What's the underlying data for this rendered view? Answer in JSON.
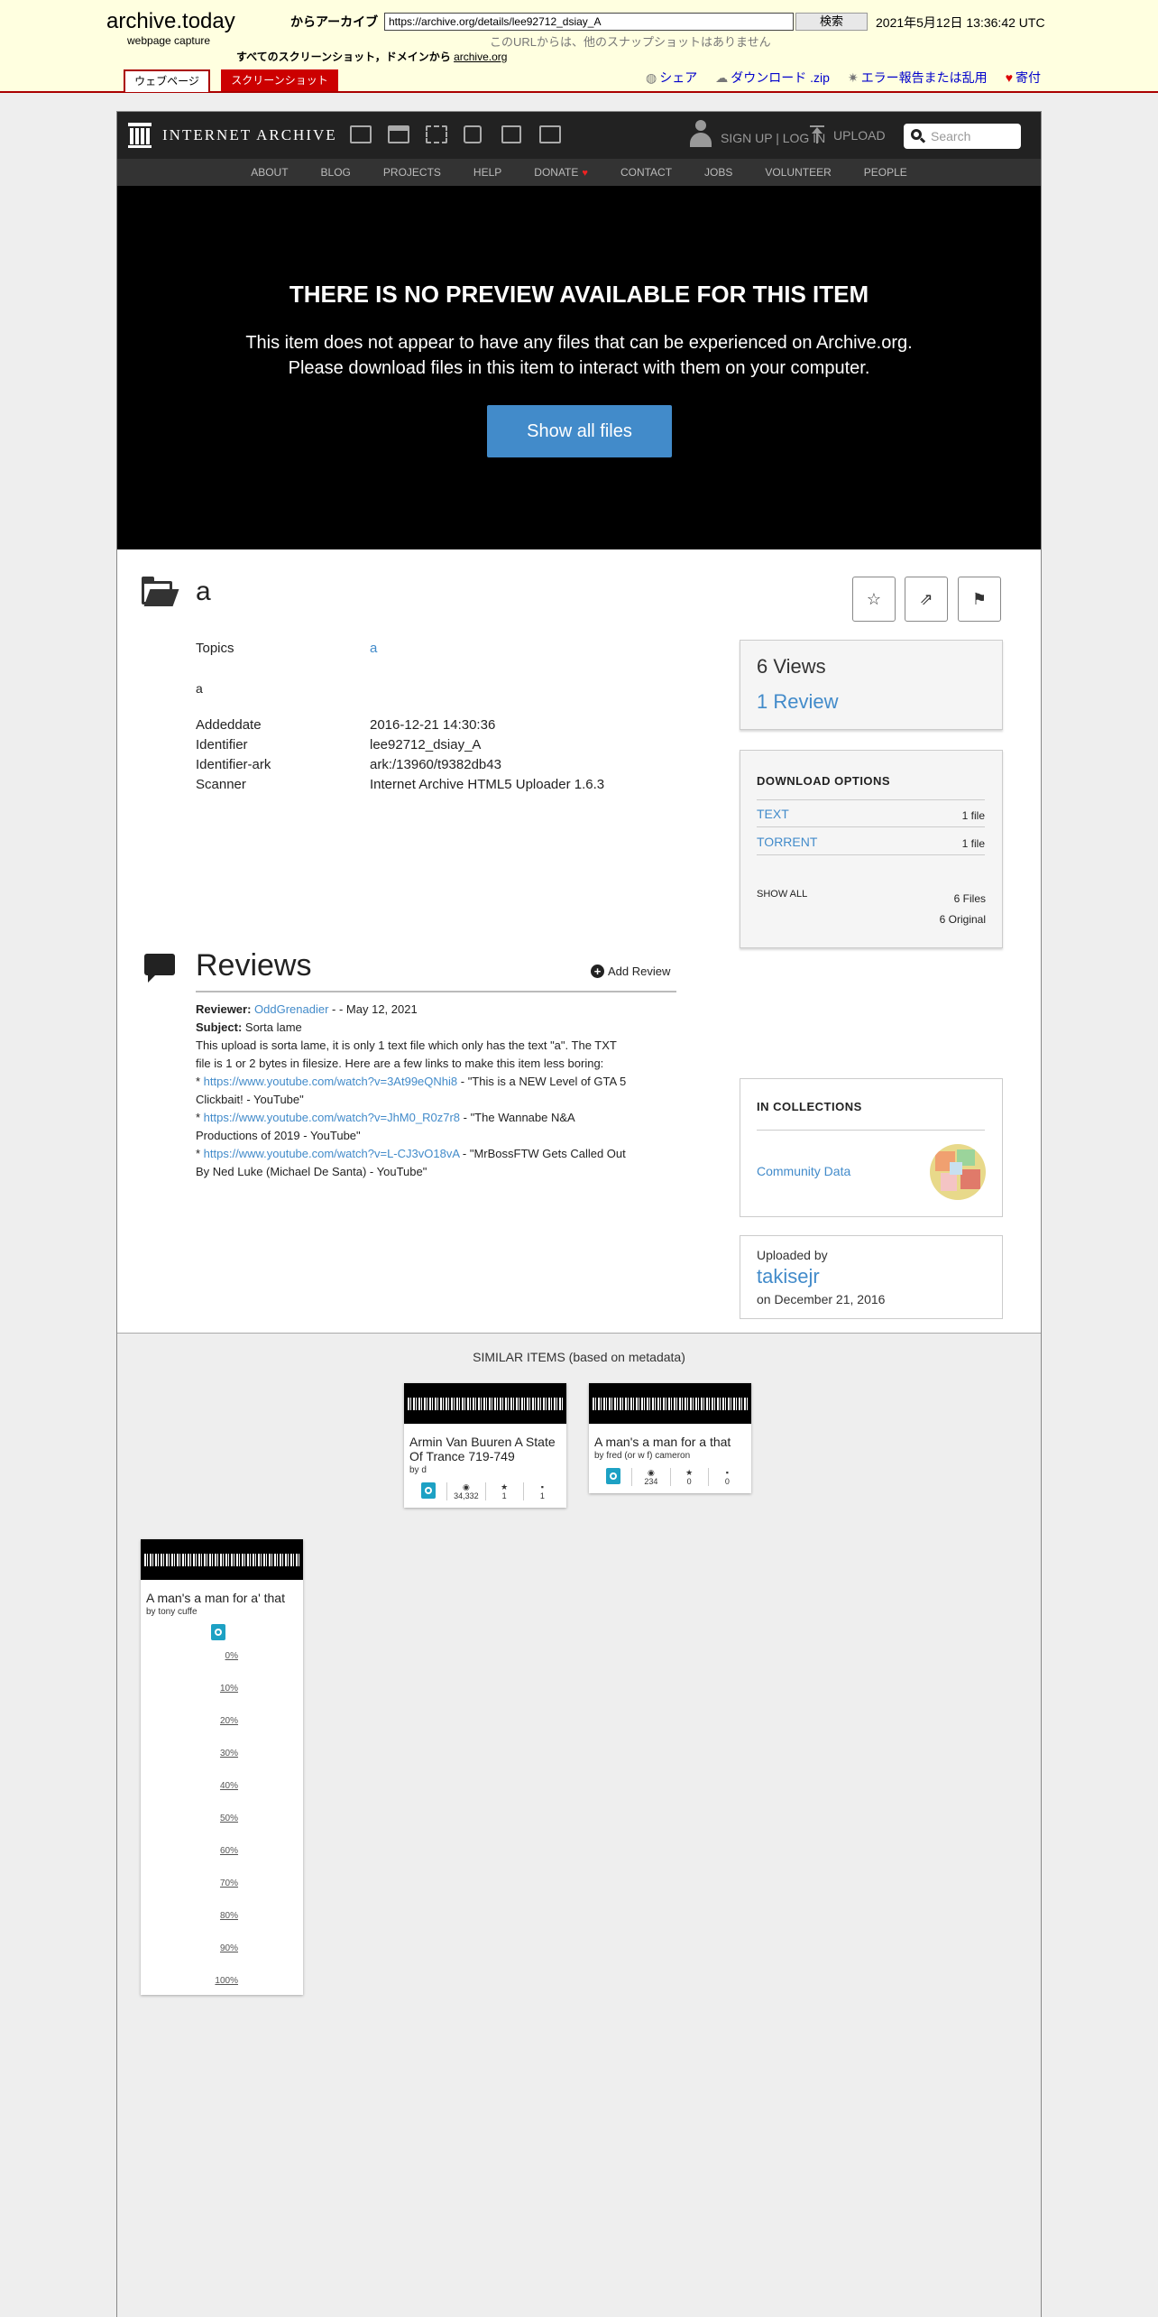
{
  "archive_today": {
    "logo": "archive.today",
    "subtitle": "webpage capture",
    "from_label": "からアーカイブ",
    "url_value": "https://archive.org/details/lee92712_dsiay_A",
    "search_button": "検索",
    "capture_date": "2021年5月12日 13:36:42 UTC",
    "no_snapshots": "このURLからは、他のスナップショットはありません",
    "all_snapshots_prefix": "すべてのスクリーンショット，ドメインから",
    "all_snapshots_domain": "archive.org",
    "tab_webpage": "ウェブページ",
    "tab_screenshot": "スクリーンショット",
    "action_share": "シェア",
    "action_download": "ダウンロード .zip",
    "action_report": "エラー報告または乱用",
    "action_donate": "寄付"
  },
  "ia_nav": {
    "logo_text": "INTERNET ARCHIVE",
    "signup": "SIGN UP | LOG IN",
    "upload": "UPLOAD",
    "search_placeholder": "Search",
    "subnav": [
      "ABOUT",
      "BLOG",
      "PROJECTS",
      "HELP",
      "DONATE",
      "CONTACT",
      "JOBS",
      "VOLUNTEER",
      "PEOPLE"
    ]
  },
  "preview": {
    "heading": "THERE IS NO PREVIEW AVAILABLE FOR THIS ITEM",
    "line1": "This item does not appear to have any files that can be experienced on Archive.org.",
    "line2": "Please download files in this item to interact with them on your computer.",
    "button": "Show all files"
  },
  "item": {
    "title": "a",
    "topics_label": "Topics",
    "topics_value": "a",
    "description": "a",
    "addeddate_label": "Addeddate",
    "addeddate_value": "2016-12-21 14:30:36",
    "identifier_label": "Identifier",
    "identifier_value": "lee92712_dsiay_A",
    "identifier_ark_label": "Identifier-ark",
    "identifier_ark_value": "ark:/13960/t9382db43",
    "scanner_label": "Scanner",
    "scanner_value": "Internet Archive HTML5 Uploader 1.6.3"
  },
  "reviews": {
    "heading": "Reviews",
    "add_review": "Add Review",
    "reviewer_label": "Reviewer:",
    "reviewer_name": "OddGrenadier",
    "reviewer_date": " - - May 12, 2021",
    "subject_label": "Subject:",
    "subject_value": " Sorta lame",
    "body1": "This upload is sorta lame, it is only 1 text file which only has the text \"a\". The TXT",
    "body2": "file is 1 or 2 bytes in filesize. Here are a few links to make this item less boring:",
    "link1": "https://www.youtube.com/watch?v=3At99eQNhi8",
    "link1_desc": " - \"This is a NEW Level of GTA 5",
    "link1_desc2": "Clickbait! - YouTube\"",
    "link2": "https://www.youtube.com/watch?v=JhM0_R0z7r8",
    "link2_desc": " - \"The Wannabe N&A",
    "link2_desc2": "Productions of 2019 - YouTube\"",
    "link3": "https://www.youtube.com/watch?v=L-CJ3vO18vA",
    "link3_desc": " - \"MrBossFTW Gets Called Out",
    "link3_desc2": "By Ned Luke (Michael De Santa) - YouTube\""
  },
  "sidebar": {
    "views": "6 Views",
    "reviews_link": "1 Review",
    "download_heading": "DOWNLOAD OPTIONS",
    "downloads": [
      {
        "label": "TEXT",
        "count": "1 file"
      },
      {
        "label": "TORRENT",
        "count": "1 file"
      }
    ],
    "show_all": "SHOW ALL",
    "files_count": "6 Files",
    "original_count": "6 Original",
    "collections_heading": "IN COLLECTIONS",
    "collection_name": "Community Data",
    "uploaded_by_label": "Uploaded by",
    "uploader": "takisejr",
    "upload_date": "on December 21, 2016"
  },
  "similar": {
    "heading": "SIMILAR ITEMS (based on metadata)",
    "cards": [
      {
        "title_line1": "Armin Van Buuren A State",
        "title_line2": "Of Trance 719-749",
        "by": "by d",
        "views": "34,332",
        "favs": "1",
        "reviews": "1"
      },
      {
        "title_line1": "A man's a man for a that",
        "title_line2": "",
        "by": "by fred (or w f) cameron",
        "views": "234",
        "favs": "0",
        "reviews": "0"
      },
      {
        "title_line1": "A man's a man for a' that",
        "title_line2": "",
        "by": "by tony cuffe"
      }
    ],
    "percentages": [
      "0%",
      "10%",
      "20%",
      "30%",
      "40%",
      "50%",
      "60%",
      "70%",
      "80%",
      "90%",
      "100%"
    ]
  }
}
